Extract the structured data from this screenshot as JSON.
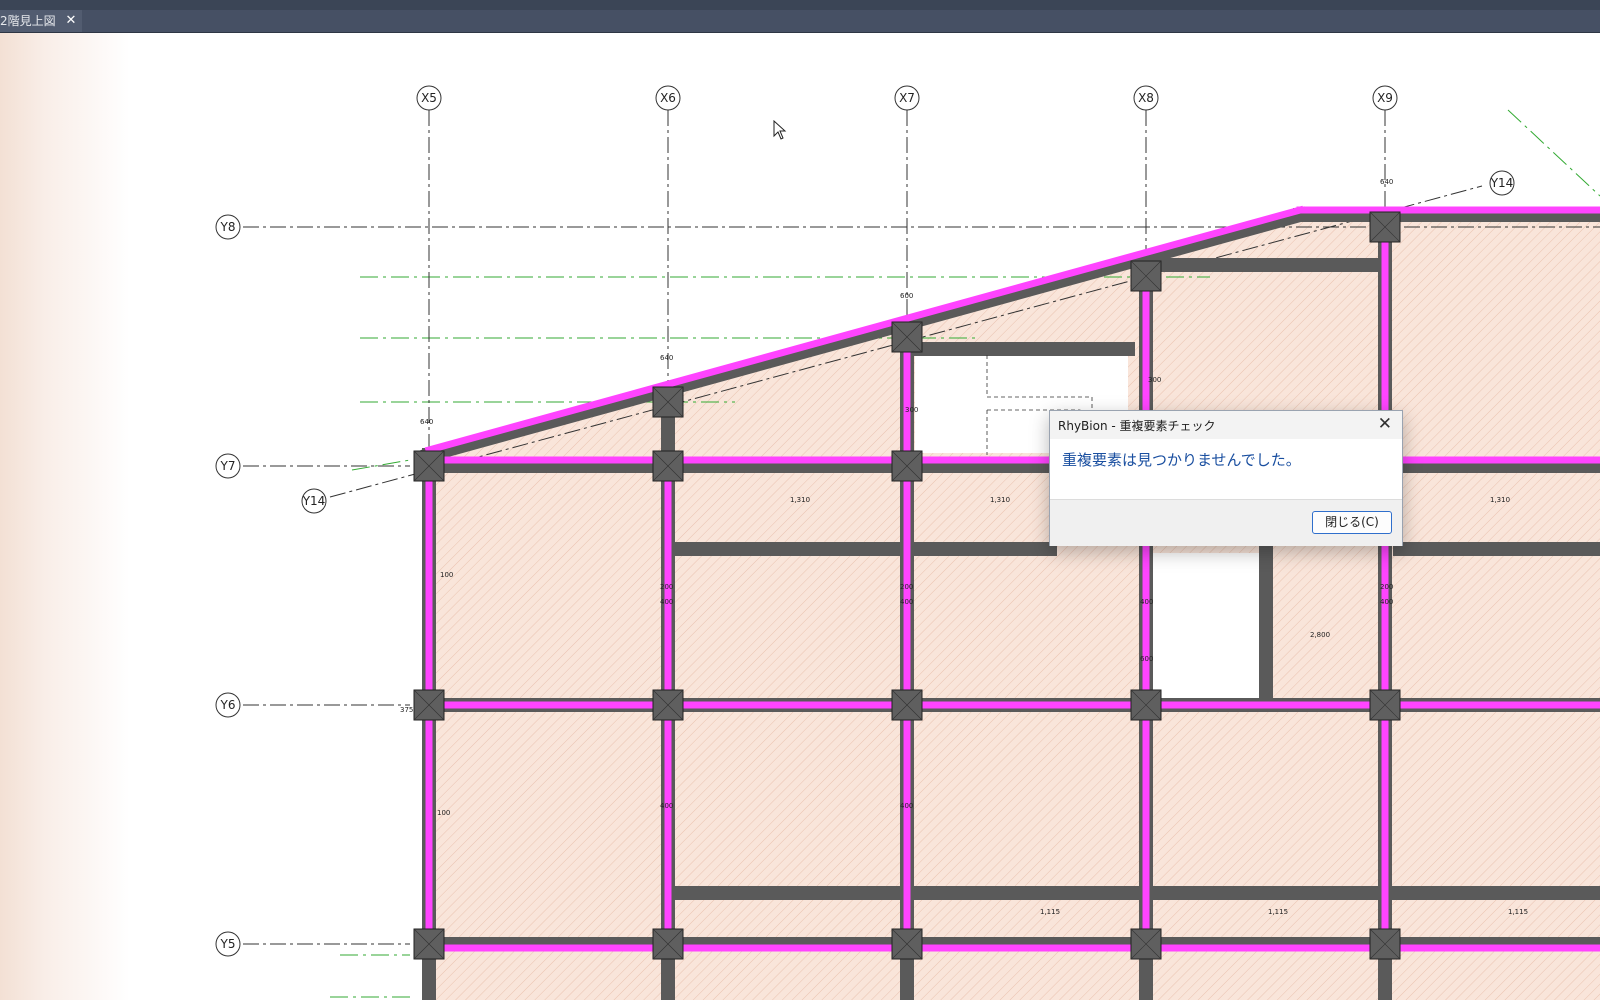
{
  "window": {
    "tab_label": "2階見上図",
    "tab_close_glyph": "✕"
  },
  "dialog": {
    "title": "RhyBion - 重複要素チェック",
    "close_glyph": "✕",
    "message": "重複要素は見つかりませんでした。",
    "close_button_label": "閉じる(C)"
  },
  "drawing": {
    "grid_x_labels": [
      "X5",
      "X6",
      "X7",
      "X8",
      "X9"
    ],
    "grid_y_labels": [
      "Y8",
      "Y7",
      "Y6",
      "Y5"
    ],
    "diagonal_grid_label": "Y14",
    "dimension_labels": [
      "640",
      "600",
      "400",
      "200",
      "300",
      "1,310",
      "2,800",
      "1,115",
      "375",
      "100"
    ]
  },
  "colors": {
    "beam": "#ff44ff",
    "beam_edge": "#5a5a5a",
    "column": "#5f5f5f",
    "slab_fill": "#f9e5da",
    "grid_line": "#333333",
    "green_line": "#33aa33",
    "title_bar": "#465064",
    "dialog_message": "#1a4fa0",
    "button_border": "#2f6fcc"
  },
  "icons": [
    "close-icon",
    "mouse-cursor-icon"
  ]
}
